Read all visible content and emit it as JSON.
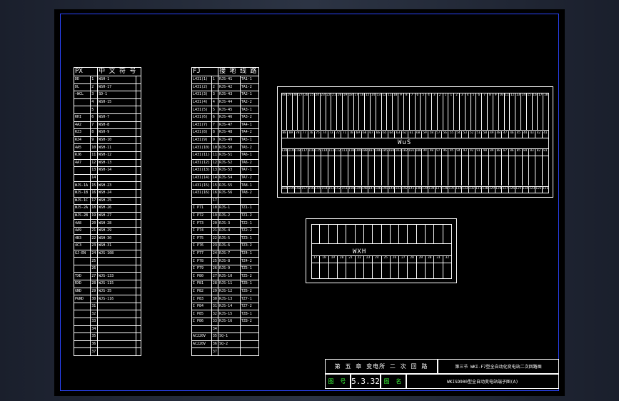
{
  "left_table": {
    "header": [
      "PX",
      "中 文 符 号"
    ],
    "rows": [
      [
        "DD",
        "1",
        "WSH-1",
        ""
      ],
      [
        "DL",
        "2",
        "WSH-17",
        ""
      ],
      [
        "—WCL",
        "3",
        "SD-1",
        ""
      ],
      [
        "",
        "4",
        "WSH-15",
        ""
      ],
      [
        "",
        "5",
        "",
        ""
      ],
      [
        "RHI",
        "6",
        "WSH-7",
        ""
      ],
      [
        "4A2",
        "7",
        "WSH-8",
        ""
      ],
      [
        "RZ3",
        "8",
        "WSH-9",
        ""
      ],
      [
        "RZ4",
        "9",
        "WSH-10",
        ""
      ],
      [
        "4A5",
        "10",
        "WSH-11",
        ""
      ],
      [
        "RJ6",
        "11",
        "WSH-12",
        ""
      ],
      [
        "4A7",
        "12",
        "WSH-13",
        ""
      ],
      [
        "",
        "13",
        "WSH-14",
        ""
      ],
      [
        "",
        "14",
        "",
        ""
      ],
      [
        "WJS-1A",
        "15",
        "WSH-23",
        ""
      ],
      [
        "WJS-1B",
        "16",
        "WSH-24",
        ""
      ],
      [
        "WJS-1C",
        "17",
        "WSH-25",
        ""
      ],
      [
        "WJS-2A",
        "18",
        "WSH-26",
        ""
      ],
      [
        "WJS-2B",
        "19",
        "WSH-27",
        ""
      ],
      [
        "4A8",
        "20",
        "WSH-28",
        ""
      ],
      [
        "4A9",
        "21",
        "WSH-29",
        ""
      ],
      [
        "4B3",
        "22",
        "WSH-30",
        ""
      ],
      [
        "4C3",
        "23",
        "WSH-31",
        ""
      ],
      [
        "GJ-EN",
        "24",
        "WJS-108",
        ""
      ],
      [
        "",
        "25",
        "",
        ""
      ],
      [
        "",
        "26",
        "",
        ""
      ],
      [
        "TXD",
        "27",
        "WJS-133",
        ""
      ],
      [
        "RXD",
        "28",
        "WJS-115",
        ""
      ],
      [
        "GND",
        "29",
        "WJS-35",
        ""
      ],
      [
        "PGND",
        "30",
        "WJS-116",
        ""
      ],
      [
        "",
        "31",
        "",
        ""
      ],
      [
        "",
        "32",
        "",
        ""
      ],
      [
        "",
        "33",
        "",
        ""
      ],
      [
        "",
        "34",
        "",
        ""
      ],
      [
        "",
        "35",
        "",
        ""
      ],
      [
        "",
        "36",
        "",
        ""
      ],
      [
        "",
        "37",
        "",
        ""
      ]
    ]
  },
  "right_table": {
    "header": [
      "FJ",
      "接 地 线 路"
    ],
    "rows": [
      [
        "L431(1)",
        "1",
        "RJS-41",
        "TA1-1"
      ],
      [
        "L431(2)",
        "2",
        "RJS-42",
        "TA1-2"
      ],
      [
        "L431(3)",
        "3",
        "RJS-43",
        "TA2-1"
      ],
      [
        "L431(4)",
        "4",
        "RJS-44",
        "TA2-2"
      ],
      [
        "L431(5)",
        "5",
        "RJS-45",
        "TA3-1"
      ],
      [
        "L431(6)",
        "6",
        "RJS-46",
        "TA3-2"
      ],
      [
        "L431(7)",
        "7",
        "RJS-47",
        "TA4-1"
      ],
      [
        "L431(8)",
        "8",
        "RJS-48",
        "TA4-2"
      ],
      [
        "L431(9)",
        "9",
        "RJS-49",
        "TA5-1"
      ],
      [
        "L431(10)",
        "10",
        "RJS-50",
        "TA5-2"
      ],
      [
        "L431(11)",
        "11",
        "RJS-51",
        "TA6-1"
      ],
      [
        "L431(12)",
        "12",
        "RJS-52",
        "TA6-2"
      ],
      [
        "L431(13)",
        "13",
        "RJS-53",
        "TA7-1"
      ],
      [
        "L431(14)",
        "14",
        "RJS-54",
        "TA7-2"
      ],
      [
        "L431(15)",
        "15",
        "RJS-55",
        "TA8-1"
      ],
      [
        "L431(16)",
        "16",
        "RJS-56",
        "TA8-2"
      ],
      [
        "",
        "17",
        "",
        ""
      ],
      [
        "I P71",
        "18",
        "RJS-1",
        "TZ1-1"
      ],
      [
        "I P72",
        "19",
        "RJS-2",
        "TZ1-2"
      ],
      [
        "I P73",
        "20",
        "RJS-3",
        "TZ2-1"
      ],
      [
        "I P74",
        "21",
        "RJS-4",
        "TZ2-2"
      ],
      [
        "I P75",
        "22",
        "RJS-5",
        "TZ3-1"
      ],
      [
        "I P76",
        "23",
        "RJS-6",
        "TZ3-2"
      ],
      [
        "I P77",
        "24",
        "RJS-7",
        "TZ4-1"
      ],
      [
        "I P78",
        "25",
        "RJS-8",
        "TZ4-2"
      ],
      [
        "I P79",
        "26",
        "RJS-9",
        "TZ5-1"
      ],
      [
        "I P80",
        "27",
        "RJS-10",
        "TZ5-2"
      ],
      [
        "I P81",
        "28",
        "RJS-11",
        "TZ6-1"
      ],
      [
        "I P82",
        "29",
        "RJS-12",
        "TZ6-2"
      ],
      [
        "I P83",
        "30",
        "RJS-13",
        "TZ7-1"
      ],
      [
        "I P84",
        "31",
        "RJS-14",
        "TZ7-2"
      ],
      [
        "I P85",
        "32",
        "RJS-15",
        "TZ8-1"
      ],
      [
        "I P86",
        "33",
        "RJS-16",
        "TZ8-2"
      ],
      [
        "",
        "34",
        "",
        ""
      ],
      [
        "AC220V",
        "35",
        "SQ-1",
        ""
      ],
      [
        "AC220V",
        "36",
        "SQ-2",
        ""
      ],
      [
        "",
        "37",
        "",
        ""
      ]
    ]
  },
  "wus": {
    "label": "WuS",
    "top_numbers": [
      "48",
      "29",
      "30",
      "27",
      "26",
      "25",
      "24",
      "23",
      "22",
      "21",
      "20",
      "19",
      "18",
      "17",
      "16",
      "15",
      "14",
      "13",
      "12",
      "11",
      "10",
      "9",
      "8",
      "7",
      "6",
      "5",
      "4",
      "3",
      "2",
      "1",
      "1",
      "2",
      "3",
      "4",
      "5",
      "6",
      "7",
      "8",
      "9",
      "10",
      "11",
      "12",
      "13",
      "14",
      "15",
      "16",
      "17",
      "18"
    ],
    "mid_numbers": [
      "88",
      "89",
      "78",
      "77",
      "76",
      "75",
      "74",
      "73",
      "72",
      "71",
      "70",
      "69",
      "68",
      "67",
      "66",
      "65",
      "64",
      "63",
      "62",
      "61",
      "60",
      "59",
      "58",
      "57",
      "56",
      "55",
      "54",
      "53",
      "52",
      "51",
      "50",
      "49",
      "48",
      "47",
      "46",
      "45",
      "44",
      "43",
      "42",
      "41"
    ],
    "low_numbers": [
      "120",
      "119",
      "118",
      "117",
      "116",
      "115",
      "114",
      "113",
      "112",
      "111",
      "110",
      "109",
      "108",
      "107",
      "106",
      "105",
      "104",
      "103",
      "102",
      "101",
      "100",
      "99",
      "98",
      "97",
      "96",
      "95",
      "94",
      "93",
      "92",
      "91",
      "90",
      "89",
      "88",
      "87",
      "86",
      "85",
      "84",
      "83",
      "82",
      "81"
    ],
    "bottom_numbers": [
      "160",
      "159",
      "158",
      "157",
      "156",
      "155",
      "154",
      "153",
      "152",
      "151",
      "150",
      "149",
      "148",
      "147",
      "146",
      "145",
      "144",
      "143",
      "142",
      "141",
      "140",
      "139",
      "138",
      "137",
      "136",
      "135",
      "134",
      "133",
      "132",
      "131",
      "130",
      "129",
      "128",
      "127",
      "126",
      "125",
      "124",
      "123",
      "122",
      "121"
    ]
  },
  "wxh": {
    "label": "WXH",
    "top_numbers": [
      "1",
      "2",
      "3",
      "4",
      "5",
      "6",
      "7",
      "8",
      "9",
      "10",
      "11",
      "12",
      "13",
      "14",
      "15",
      "16"
    ],
    "bottom_numbers": [
      "17",
      "18",
      "19",
      "20",
      "21",
      "22",
      "23",
      "24",
      "25",
      "26",
      "27",
      "28",
      "29",
      "30",
      "31",
      "32"
    ]
  },
  "title_block": {
    "chapter": "第 五 章  变电所 二 次 回 路",
    "section": "第三节 WKI-F7型全自动化变电站二次回路图",
    "drawing_no_label": "图 号",
    "drawing_no": "5.3.32",
    "drawing_name_label": "图 名",
    "drawing_name": "WKISD900型全自动变电站端子图(A)"
  },
  "colors": {
    "sheet": "#000000",
    "border": "#2b46ff",
    "lines": "#ffffff",
    "accent": "#3cff3c"
  }
}
